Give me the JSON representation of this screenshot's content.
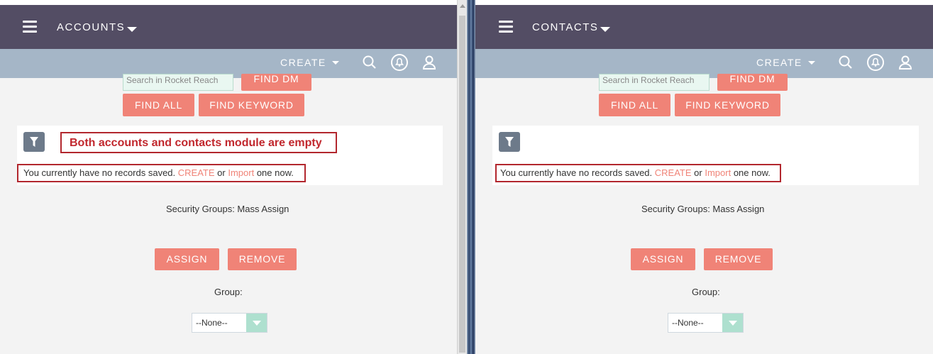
{
  "left": {
    "module_title": "ACCOUNTS",
    "create_label": "CREATE",
    "search_placeholder": "Search in Rocket Reach",
    "find_dm": "FIND DM",
    "find_all": "FIND ALL",
    "find_keyword": "FIND KEYWORD",
    "annotation": "Both accounts and contacts module are empty",
    "no_records_prefix": "You currently have no records saved.",
    "no_records_create": "CREATE",
    "no_records_or": "or",
    "no_records_import": "Import",
    "no_records_suffix": "one now.",
    "security_groups": "Security Groups: Mass Assign",
    "assign": "ASSIGN",
    "remove": "REMOVE",
    "group_label": "Group:",
    "group_value": "--None--"
  },
  "right": {
    "module_title": "CONTACTS",
    "create_label": "CREATE",
    "search_placeholder": "Search in Rocket Reach",
    "find_dm": "FIND DM",
    "find_all": "FIND ALL",
    "find_keyword": "FIND KEYWORD",
    "no_records_prefix": "You currently have no records saved.",
    "no_records_create": "CREATE",
    "no_records_or": "or",
    "no_records_import": "Import",
    "no_records_suffix": "one now.",
    "security_groups": "Security Groups: Mass Assign",
    "assign": "ASSIGN",
    "remove": "REMOVE",
    "group_label": "Group:",
    "group_value": "--None--"
  },
  "icons": [
    "hamburger-icon",
    "caret-down-icon",
    "search-icon",
    "notification-bell-icon",
    "user-icon",
    "filter-icon"
  ],
  "colors": {
    "nav": "#534d64",
    "subbar": "#a5b6c7",
    "button": "#f08377",
    "annotation": "#c1272d",
    "select_arrow": "#aee0cf"
  }
}
